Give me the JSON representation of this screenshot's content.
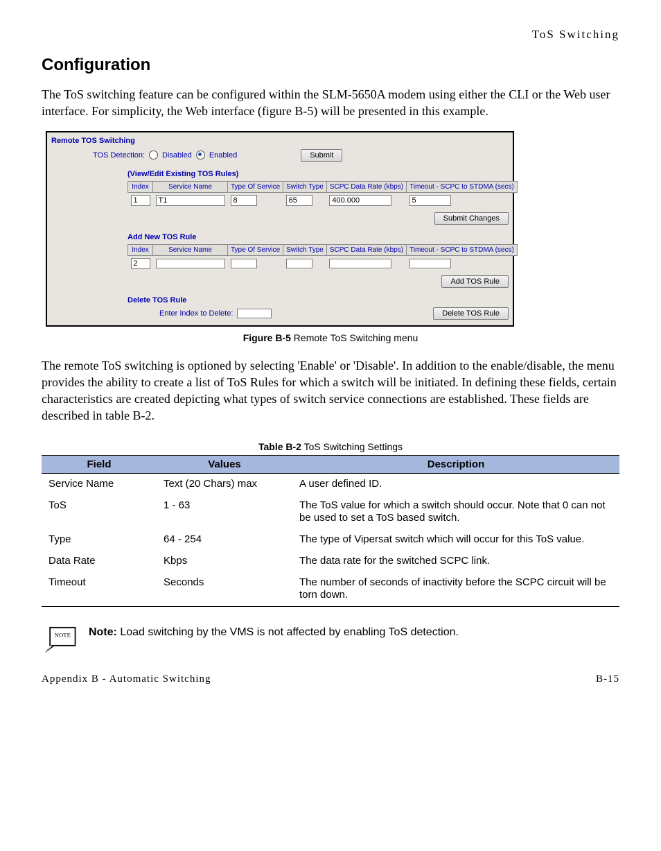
{
  "header": {
    "running": "ToS Switching"
  },
  "section": {
    "title": "Configuration"
  },
  "para1": "The ToS switching feature can be configured within the SLM-5650A modem using either the CLI or the Web user interface. For simplicity, the Web interface (figure B-5) will be presented in this example.",
  "figure": {
    "legend": "Remote TOS Switching",
    "detection_label": "TOS Detection:",
    "radio_disabled": "Disabled",
    "radio_enabled": "Enabled",
    "submit": "Submit",
    "view_title": "(View/Edit Existing TOS Rules)",
    "cols": {
      "index": "Index",
      "service": "Service Name",
      "tos": "Type Of Service",
      "switch": "Switch Type",
      "rate": "SCPC Data Rate (kbps)",
      "timeout": "Timeout - SCPC to STDMA (secs)"
    },
    "existing": {
      "index": "1",
      "service": "T1",
      "tos": "8",
      "switch": "65",
      "rate": "400.000",
      "timeout": "5"
    },
    "submit_changes": "Submit Changes",
    "add_title": "Add New TOS Rule",
    "add": {
      "index": "2",
      "service": "",
      "tos": "",
      "switch": "",
      "rate": "",
      "timeout": ""
    },
    "add_btn": "Add TOS Rule",
    "del_title": "Delete TOS Rule",
    "del_label": "Enter Index to Delete:",
    "del_btn": "Delete TOS Rule"
  },
  "caption": {
    "bold": "Figure B-5",
    "rest": "  Remote ToS Switching menu"
  },
  "para2": "The remote ToS switching is optioned by selecting 'Enable' or 'Disable'. In addition to the enable/disable, the menu provides the ability to create a list of ToS Rules for which a switch will be initiated. In defining these fields, certain characteristics are created depicting what types of switch service connections are established. These fields are described in table B-2.",
  "table_caption": {
    "bold": "Table B-2",
    "rest": "  ToS Switching Settings"
  },
  "table": {
    "head": {
      "field": "Field",
      "values": "Values",
      "desc": "Description"
    },
    "rows": [
      {
        "field": "Service Name",
        "values": "Text (20 Chars) max",
        "desc": "A user defined ID."
      },
      {
        "field": "ToS",
        "values": "1 - 63",
        "desc": "The ToS value for which a switch should occur. Note that 0 can not be used to set a ToS based switch."
      },
      {
        "field": "Type",
        "values": "64 - 254",
        "desc": "The type of Vipersat switch which will occur for this ToS value."
      },
      {
        "field": "Data Rate",
        "values": "Kbps",
        "desc": "The data rate for the switched SCPC link."
      },
      {
        "field": "Timeout",
        "values": "Seconds",
        "desc": "The number of seconds of inactivity before the SCPC circuit will be torn down."
      }
    ]
  },
  "note": {
    "badge": "NOTE",
    "bold": "Note:",
    "rest": "  Load switching by the VMS is not affected by enabling ToS detection."
  },
  "footer": {
    "left": "Appendix B - Automatic Switching",
    "right": "B-15"
  }
}
